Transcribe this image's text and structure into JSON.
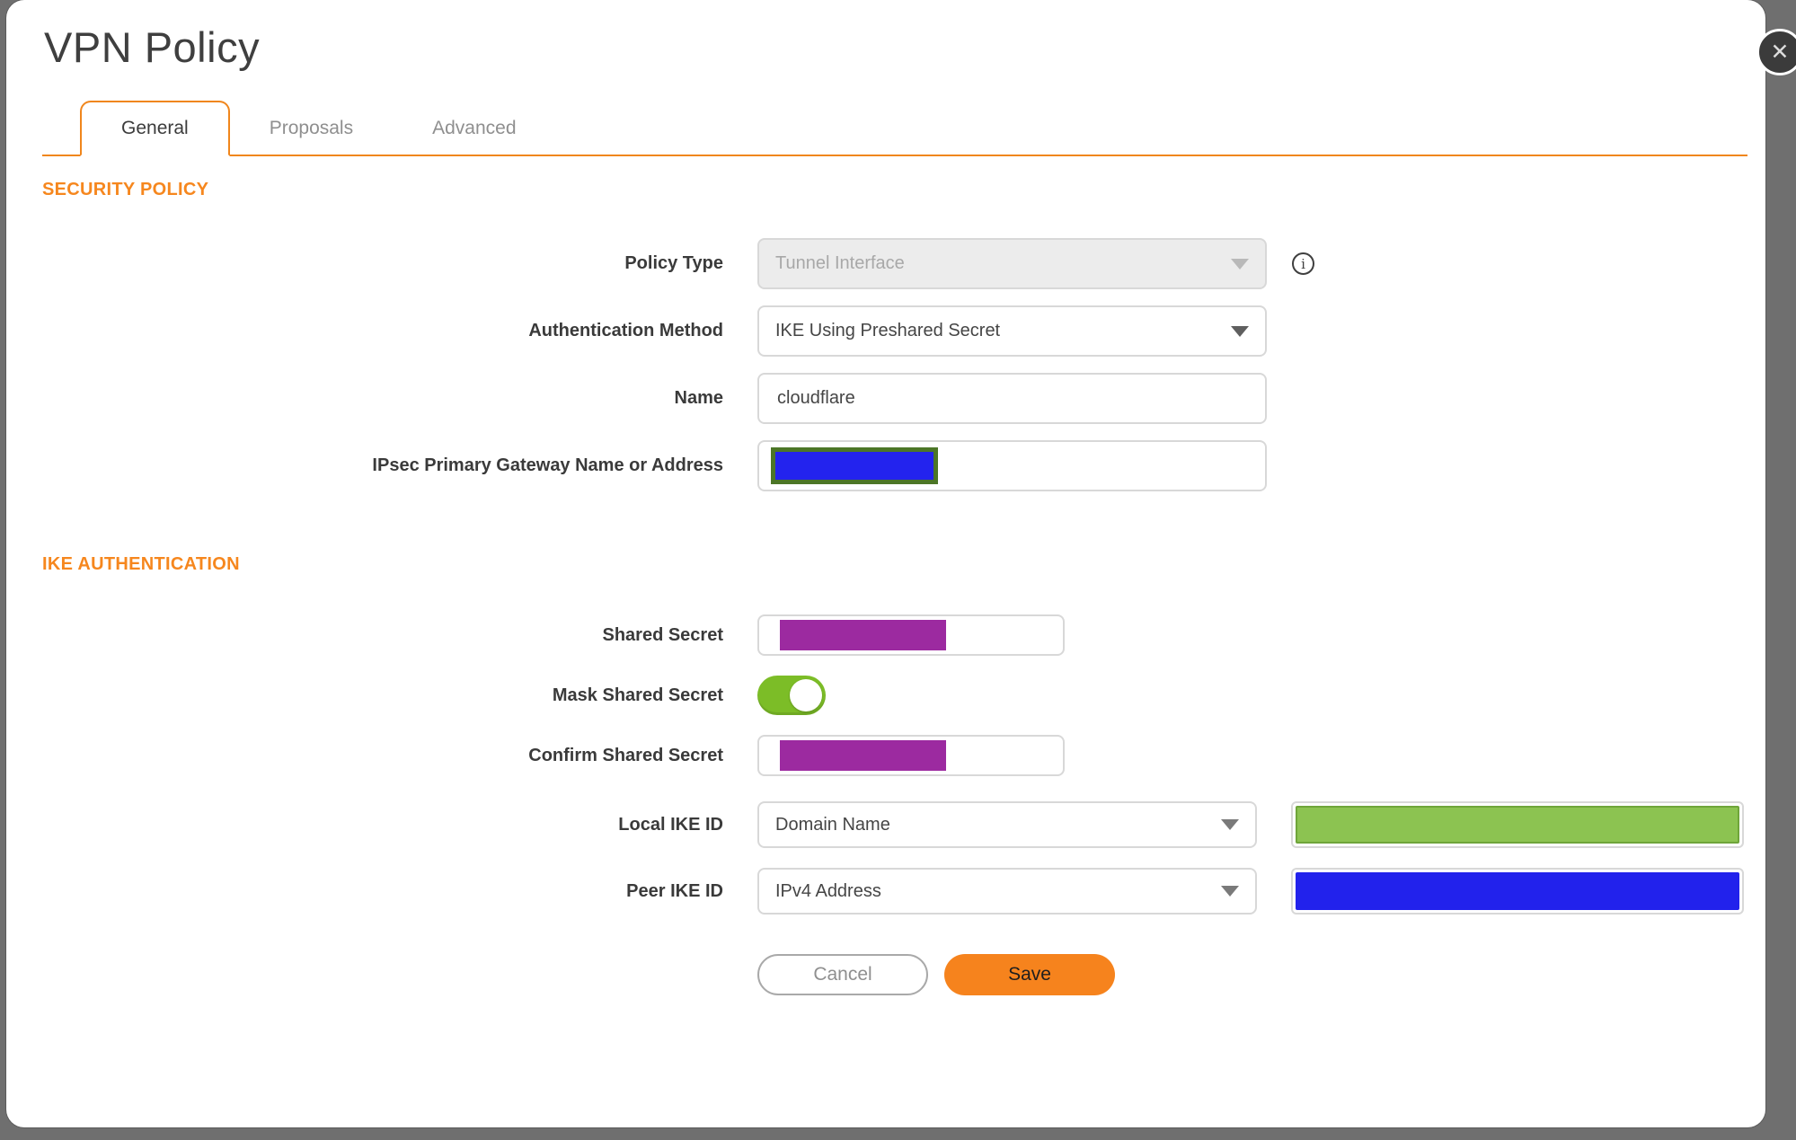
{
  "dialog": {
    "title": "VPN Policy",
    "close_icon": "✕",
    "info_icon": "i"
  },
  "tabs": [
    {
      "label": "General",
      "active": true
    },
    {
      "label": "Proposals",
      "active": false
    },
    {
      "label": "Advanced",
      "active": false
    }
  ],
  "sections": {
    "security_policy": {
      "heading": "SECURITY POLICY",
      "policy_type": {
        "label": "Policy Type",
        "value": "Tunnel Interface",
        "disabled": true
      },
      "auth_method": {
        "label": "Authentication Method",
        "value": "IKE Using Preshared Secret"
      },
      "name": {
        "label": "Name",
        "value": "cloudflare"
      },
      "gateway": {
        "label": "IPsec Primary Gateway Name or Address",
        "value": "",
        "redaction": "blue-box-olive-border"
      }
    },
    "ike_authentication": {
      "heading": "IKE AUTHENTICATION",
      "shared_secret": {
        "label": "Shared Secret",
        "redaction": "purple"
      },
      "mask_shared_secret": {
        "label": "Mask Shared Secret",
        "toggle_on": true
      },
      "confirm_shared_secret": {
        "label": "Confirm Shared Secret",
        "redaction": "purple"
      },
      "local_ike_id": {
        "label": "Local IKE ID",
        "value": "Domain Name",
        "redaction": "green"
      },
      "peer_ike_id": {
        "label": "Peer IKE ID",
        "value": "IPv4 Address",
        "redaction": "blue"
      }
    }
  },
  "footer": {
    "cancel_label": "Cancel",
    "save_label": "Save"
  },
  "colors": {
    "accent_orange": "#F6871E",
    "save_orange": "#F6831D",
    "toggle_green": "#7CBD27",
    "redaction_purple": "#9C2AA0",
    "redaction_blue": "#2222EC",
    "redaction_green": "#8CC351",
    "redaction_olive_border": "#4C7627",
    "backdrop_gray": "#6F6F6F"
  }
}
